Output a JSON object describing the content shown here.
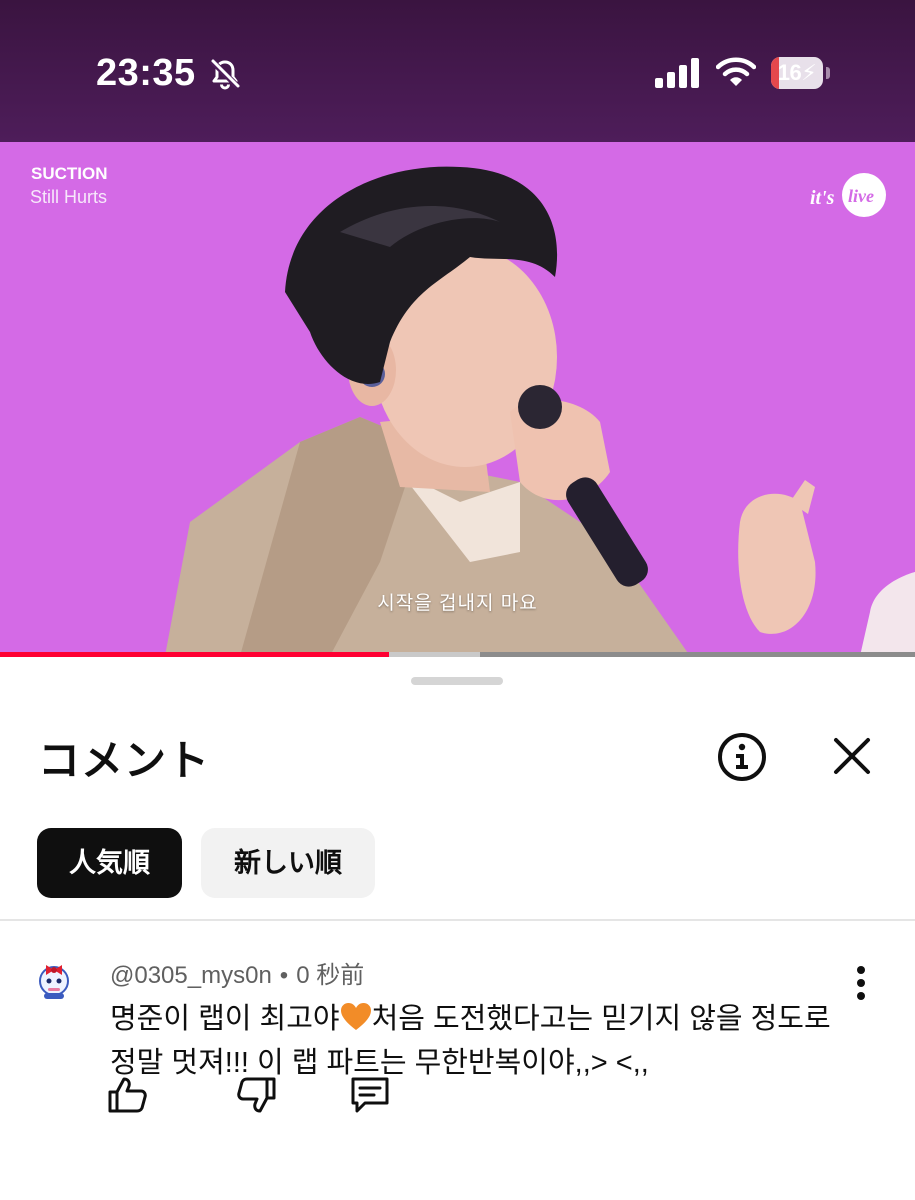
{
  "status_bar": {
    "time": "23:35",
    "battery": "16",
    "battery_level": 0.16,
    "icons": [
      "bell-muted-icon",
      "signal-icon",
      "wifi-icon",
      "battery-charging-icon"
    ]
  },
  "video": {
    "artist": "SUCTION",
    "title": "Still Hurts",
    "channel_logo": "it's live",
    "subtitle": "시작을 겁내지 마요",
    "progress": 0.425,
    "buffered": 0.525
  },
  "comments_panel": {
    "title": "コメント",
    "info_icon": "info-icon",
    "close_icon": "close-icon",
    "sort_chips": [
      {
        "label": "人気順",
        "selected": true
      },
      {
        "label": "新しい順",
        "selected": false
      }
    ]
  },
  "comment": {
    "author": "@0305_mys0n",
    "separator": "•",
    "time": "0 秒前",
    "text_part1": "명준이 랩이 최고야",
    "emoji": "orange-heart-icon",
    "text_part2": "처음 도전했다고는 믿기지 않을 정도로 정말 멋져!!! 이 랩 파트는 무한반복이야,,> <,,",
    "actions": [
      "thumbs-up-icon",
      "thumbs-down-icon",
      "reply-icon"
    ]
  },
  "colors": {
    "status_bar_bg": "#4a1a55",
    "video_bg": "#d46ae6",
    "progress_red": "#ff0033",
    "chip_selected_bg": "#0f0f0f",
    "chip_bg": "#f2f2f2",
    "heart": "#f28c28"
  }
}
